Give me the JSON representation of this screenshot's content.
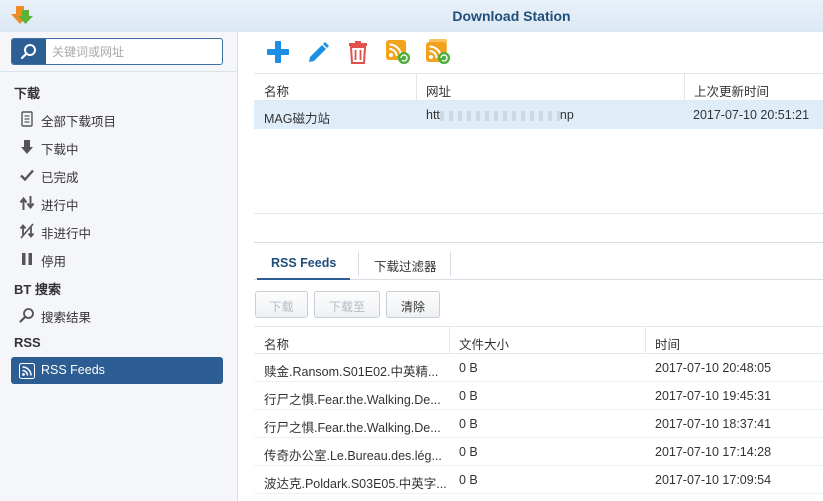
{
  "app": {
    "title": "Download Station"
  },
  "search": {
    "placeholder": "关键词或网址"
  },
  "sidebar": {
    "sections": [
      {
        "title": "下载"
      },
      {
        "title": "BT 搜索"
      },
      {
        "title": "RSS"
      }
    ],
    "items": [
      {
        "label": "全部下载项目",
        "icon": "all-downloads-icon"
      },
      {
        "label": "下载中",
        "icon": "arrow-down-icon"
      },
      {
        "label": "已完成",
        "icon": "checkmark-icon"
      },
      {
        "label": "进行中",
        "icon": "up-down-arrows-icon"
      },
      {
        "label": "非进行中",
        "icon": "inactive-icon"
      },
      {
        "label": "停用",
        "icon": "pause-icon"
      },
      {
        "label": "搜索结果",
        "icon": "search-icon"
      },
      {
        "label": "RSS Feeds",
        "icon": "rss-icon",
        "active": true
      }
    ]
  },
  "toolbar": {
    "buttons": [
      {
        "icon": "add-icon",
        "color": "#1a8fe3"
      },
      {
        "icon": "edit-pencil-icon",
        "color": "#1a8fe3"
      },
      {
        "icon": "delete-trash-icon",
        "color": "#e2514c"
      },
      {
        "icon": "rss-refresh-icon",
        "color": "#f2a21c"
      },
      {
        "icon": "rss-refresh-all-icon",
        "color": "#f2a21c"
      }
    ]
  },
  "feeds_grid": {
    "columns": [
      "名称",
      "网址",
      "上次更新时间"
    ],
    "rows": [
      {
        "name": "MAG磁力站",
        "url_start": "htt",
        "url_end": "np",
        "updated": "2017-07-10 20:51:21"
      }
    ]
  },
  "tabs": [
    {
      "label": "RSS Feeds",
      "active": true
    },
    {
      "label": "下载过滤器",
      "active": false
    }
  ],
  "actions": {
    "download": "下载",
    "download_to": "下载至",
    "clear": "清除"
  },
  "items_grid": {
    "columns": [
      "名称",
      "文件大小",
      "时间"
    ],
    "rows": [
      {
        "name": "赎金.Ransom.S01E02.中英精...",
        "size": "0 B",
        "time": "2017-07-10 20:48:05"
      },
      {
        "name": "行尸之惧.Fear.the.Walking.De...",
        "size": "0 B",
        "time": "2017-07-10 19:45:31"
      },
      {
        "name": "行尸之惧.Fear.the.Walking.De...",
        "size": "0 B",
        "time": "2017-07-10 18:37:41"
      },
      {
        "name": "传奇办公室.Le.Bureau.des.lég...",
        "size": "0 B",
        "time": "2017-07-10 17:14:28"
      },
      {
        "name": "波达克.Poldark.S03E05.中英字...",
        "size": "0 B",
        "time": "2017-07-10 17:09:54"
      }
    ]
  },
  "colors": {
    "accent": "#2c5d93",
    "title": "#1f4e79",
    "selection": "#dfedf9"
  }
}
